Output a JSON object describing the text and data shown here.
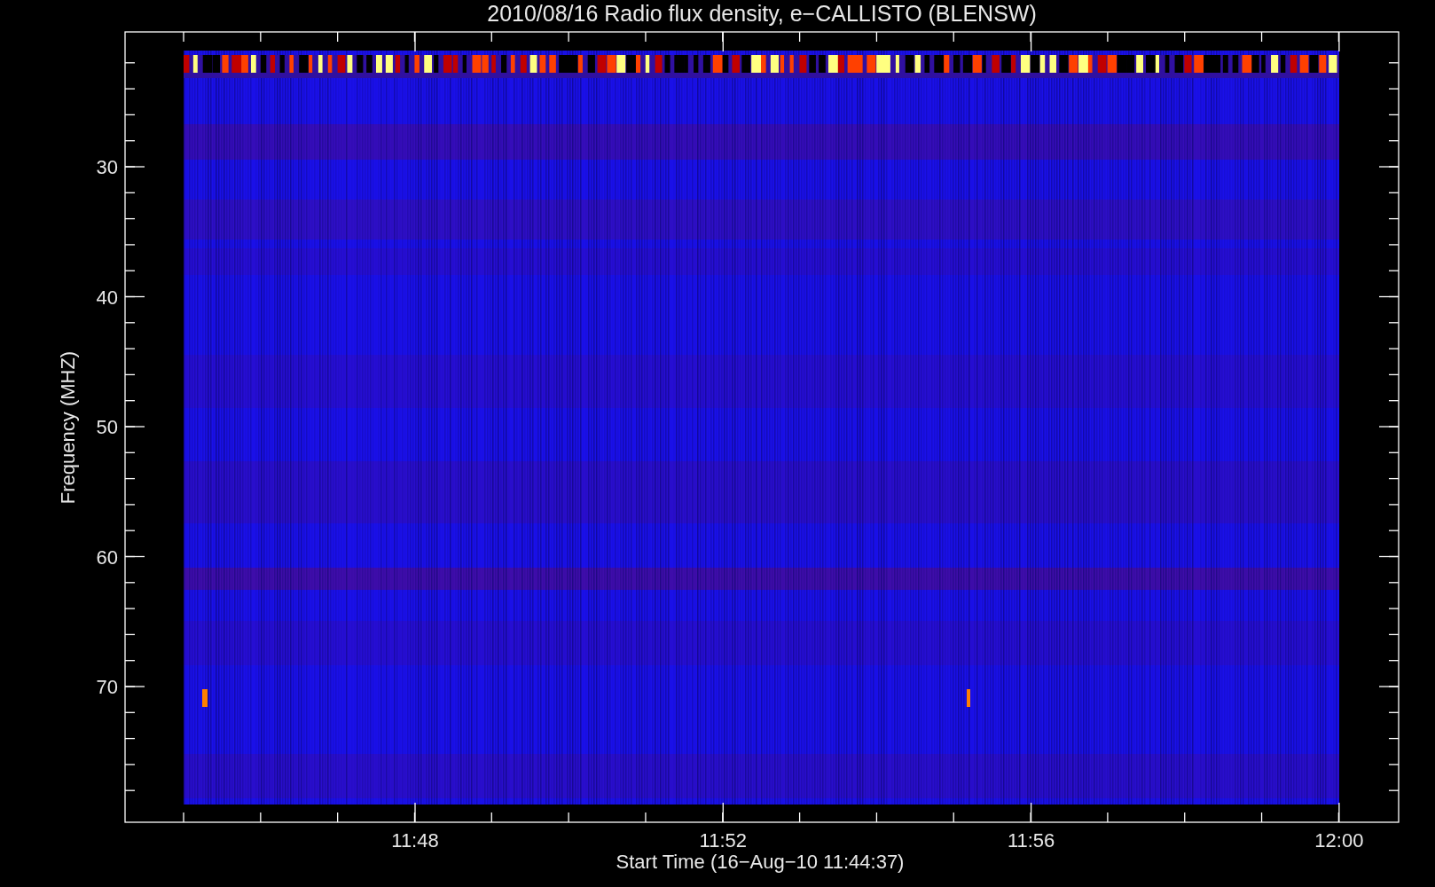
{
  "title": "2010/08/16  Radio flux density, e−CALLISTO (BLENSW)",
  "y_axis": {
    "label": "Frequency (MHZ)",
    "ticks": [
      "30",
      "40",
      "50",
      "60",
      "70"
    ]
  },
  "x_axis": {
    "label": "Start Time (16−Aug−10 11:44:37)",
    "ticks": [
      "11:48",
      "11:52",
      "11:56",
      "12:00"
    ]
  }
}
